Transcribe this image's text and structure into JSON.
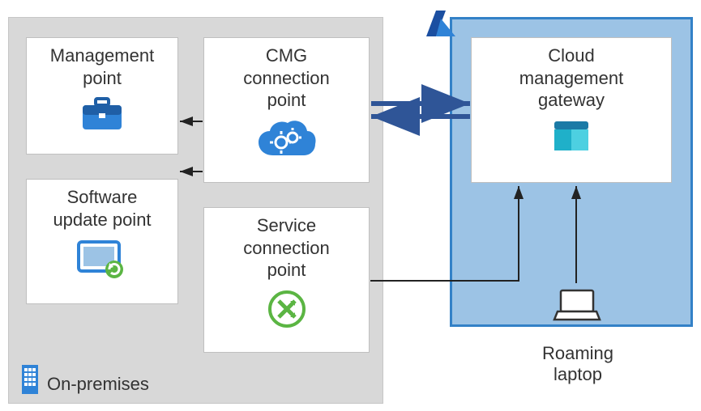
{
  "diagram": {
    "onprem_label": "On-premises",
    "roaming_label_line1": "Roaming",
    "roaming_label_line2": "laptop",
    "nodes": {
      "mgmt_point": {
        "line1": "Management",
        "line2": "point"
      },
      "cmg_conn": {
        "line1": "CMG",
        "line2": "connection",
        "line3": "point"
      },
      "sw_update": {
        "line1": "Software",
        "line2": "update point"
      },
      "svc_conn": {
        "line1": "Service",
        "line2": "connection",
        "line3": "point"
      },
      "cmg": {
        "line1": "Cloud",
        "line2": "management",
        "line3": "gateway"
      }
    }
  },
  "chart_data": {
    "type": "diagram",
    "groups": [
      {
        "id": "onprem",
        "label": "On-premises",
        "contains": [
          "mgmt_point",
          "cmg_conn",
          "sw_update",
          "svc_conn"
        ]
      },
      {
        "id": "azure",
        "label": "Azure",
        "contains": [
          "cmg"
        ]
      }
    ],
    "nodes": [
      {
        "id": "mgmt_point",
        "label": "Management point"
      },
      {
        "id": "cmg_conn",
        "label": "CMG connection point"
      },
      {
        "id": "sw_update",
        "label": "Software update point"
      },
      {
        "id": "svc_conn",
        "label": "Service connection point"
      },
      {
        "id": "cmg",
        "label": "Cloud management gateway"
      },
      {
        "id": "roaming",
        "label": "Roaming laptop"
      }
    ],
    "edges": [
      {
        "from": "cmg_conn",
        "to": "mgmt_point",
        "direction": "uni"
      },
      {
        "from": "cmg_conn",
        "to": "sw_update",
        "direction": "uni"
      },
      {
        "from": "cmg_conn",
        "to": "cmg",
        "direction": "bi"
      },
      {
        "from": "svc_conn",
        "to": "cmg",
        "direction": "uni"
      },
      {
        "from": "roaming",
        "to": "cmg",
        "direction": "uni"
      }
    ]
  }
}
